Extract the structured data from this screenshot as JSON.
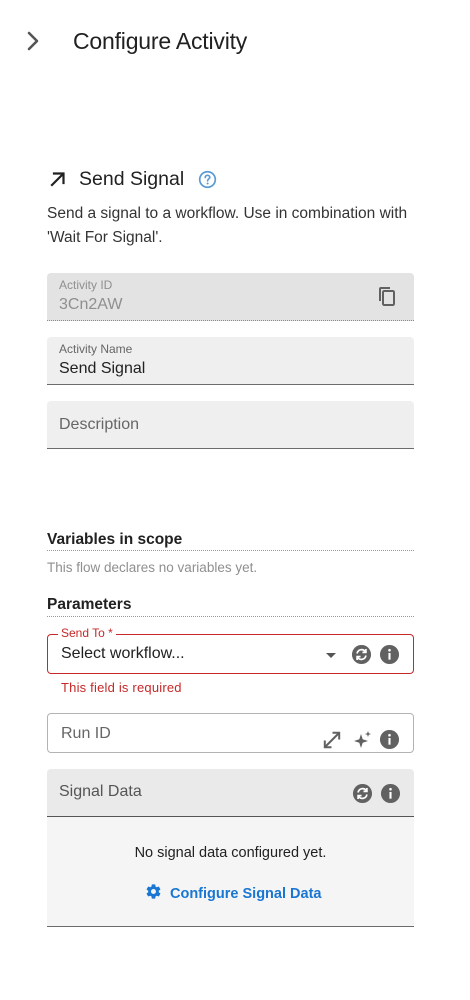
{
  "header": {
    "title": "Configure Activity"
  },
  "activity": {
    "title": "Send Signal",
    "description": "Send a signal to a workflow. Use in combination with 'Wait For Signal'."
  },
  "fields": {
    "activity_id": {
      "label": "Activity ID",
      "value": "3Cn2AW"
    },
    "activity_name": {
      "label": "Activity Name",
      "value": "Send Signal"
    },
    "description": {
      "placeholder": "Description"
    }
  },
  "variables": {
    "title": "Variables in scope",
    "note": "This flow declares no variables yet."
  },
  "parameters": {
    "title": "Parameters",
    "send_to": {
      "label": "Send To *",
      "value": "Select workflow...",
      "error": "This field is required"
    },
    "run_id": {
      "placeholder": "Run ID"
    },
    "signal_data": {
      "label": "Signal Data",
      "empty_message": "No signal data configured yet.",
      "configure_label": "Configure Signal Data"
    }
  },
  "colors": {
    "accent": "#1976d2",
    "error": "#c62828",
    "help": "#5b9bd5",
    "icon_dark": "#616161"
  },
  "icons": {
    "collapse": "chevron-right-icon",
    "activity": "arrow-up-left-icon",
    "help": "help-circle-icon",
    "copy": "copy-icon",
    "dropdown": "caret-down-icon",
    "sync": "sync-icon",
    "info": "info-icon",
    "expand": "expand-icon",
    "sparkle": "sparkle-icon",
    "gear": "gear-icon"
  }
}
